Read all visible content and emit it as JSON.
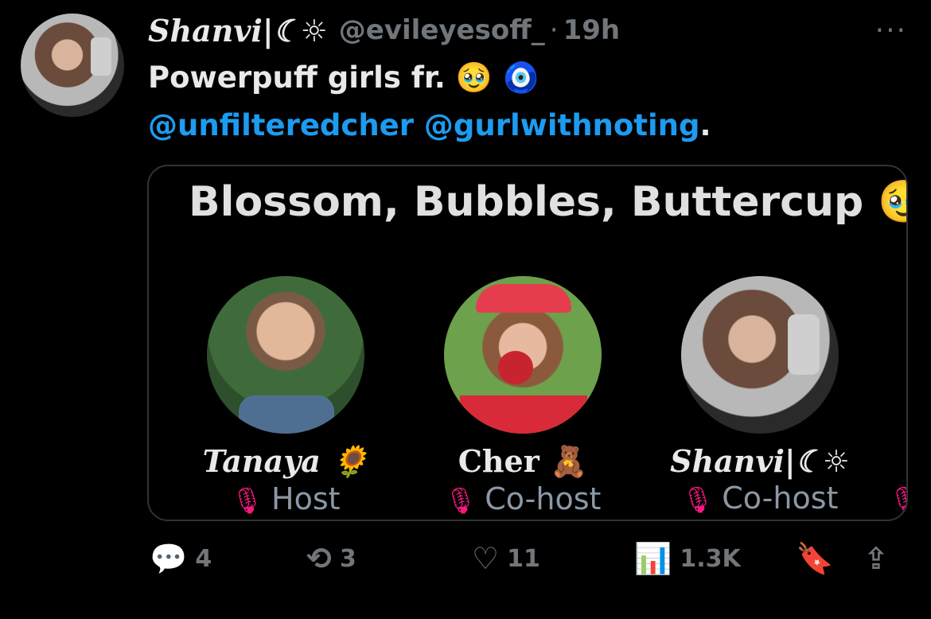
{
  "tweet": {
    "display_name": "Shanvi|☾☼",
    "handle": "@evileyesoff_",
    "separator": "·",
    "time": "19h",
    "more_label": "···",
    "text": "Powerpuff girls fr. 🥹 🧿",
    "mentions": [
      "@unfilteredcher",
      "@gurlwithnoting"
    ],
    "mentions_suffix": "."
  },
  "space_card": {
    "title": "Blossom, Bubbles, Buttercup 🥹",
    "speakers": [
      {
        "name": "Tanaya 🌻",
        "role": "Host"
      },
      {
        "name": "Cher 🧸",
        "role": "Co-host"
      },
      {
        "name": "Shanvi|☾☼",
        "role": "Co-host"
      }
    ],
    "mic_muted_icon": "mic-off-icon"
  },
  "actions": {
    "replies": "4",
    "reposts": "3",
    "likes": "11",
    "views": "1.3K"
  },
  "colors": {
    "background": "#000000",
    "text": "#e7e9ea",
    "muted": "#71767b",
    "link": "#1d9bf0",
    "mic_off": "#f91880"
  }
}
